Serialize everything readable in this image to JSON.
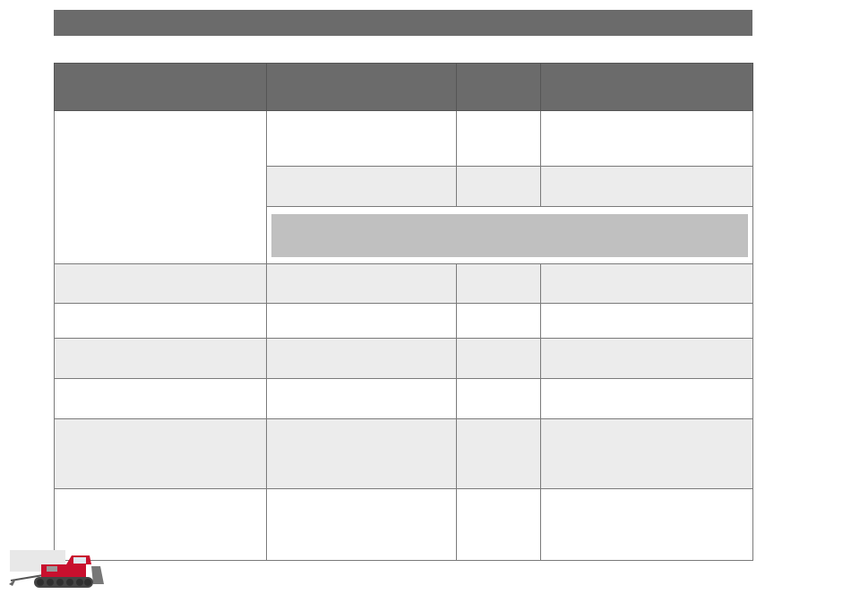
{
  "header": {
    "title": ""
  },
  "table": {
    "columns": [
      "",
      "",
      "",
      ""
    ],
    "group_row": {
      "label": "",
      "sub_rows": [
        [
          "",
          "",
          ""
        ],
        [
          "",
          "",
          ""
        ]
      ],
      "merged_note": ""
    },
    "rows": [
      [
        "",
        "",
        "",
        ""
      ],
      [
        "",
        "",
        "",
        ""
      ],
      [
        "",
        "",
        "",
        ""
      ],
      [
        "",
        "",
        "",
        ""
      ],
      [
        "",
        "",
        "",
        ""
      ],
      [
        "",
        "",
        "",
        ""
      ]
    ]
  },
  "logo": {
    "icon": "snow-groomer-icon",
    "colors": {
      "cab": "#c8102e",
      "track": "#444444",
      "body": "#9a9a9a"
    }
  }
}
